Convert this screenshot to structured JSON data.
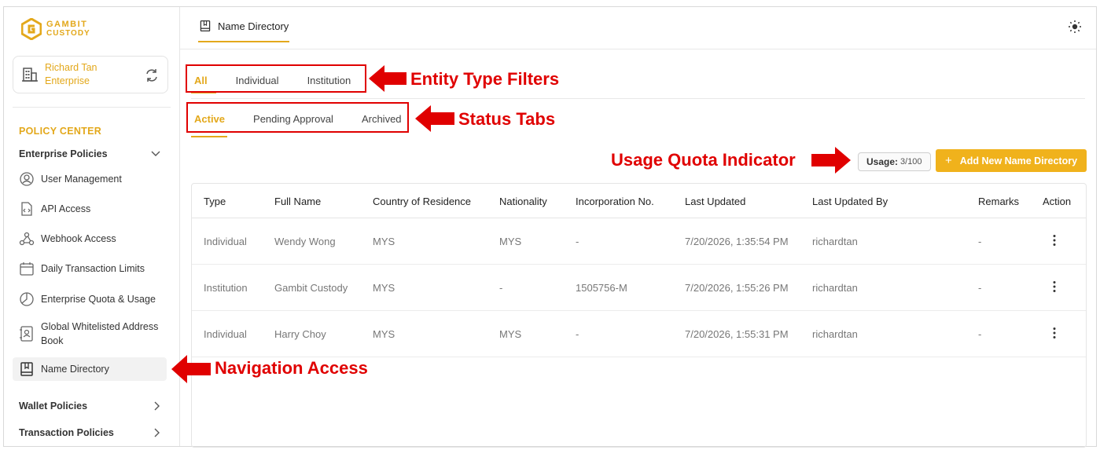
{
  "brand": {
    "line1": "GAMBIT",
    "line2": "CUSTODY",
    "accent": "#e3a81b"
  },
  "org": {
    "name": "Richard Tan Enterprise"
  },
  "sidebar": {
    "section_title": "POLICY CENTER",
    "enterprise_group": "Enterprise Policies",
    "items": [
      {
        "label": "User Management",
        "icon": "user-gear-icon"
      },
      {
        "label": "API Access",
        "icon": "api-file-icon"
      },
      {
        "label": "Webhook Access",
        "icon": "webhook-icon"
      },
      {
        "label": "Daily Transaction Limits",
        "icon": "calendar-icon"
      },
      {
        "label": "Enterprise Quota & Usage",
        "icon": "pie-chart-icon"
      },
      {
        "label": "Global Whitelisted Address Book",
        "icon": "address-book-icon"
      },
      {
        "label": "Name Directory",
        "icon": "book-icon"
      }
    ],
    "wallet_group": "Wallet Policies",
    "transaction_group": "Transaction Policies"
  },
  "header": {
    "tab_label": "Name Directory"
  },
  "entity_filters": [
    "All",
    "Individual",
    "Institution"
  ],
  "status_tabs": [
    "Active",
    "Pending Approval",
    "Archived"
  ],
  "annotations": {
    "entity": "Entity Type Filters",
    "status": "Status Tabs",
    "usage": "Usage Quota Indicator",
    "navigation": "Navigation Access",
    "color": "#e00000"
  },
  "usage": {
    "label": "Usage:",
    "value": "3/100"
  },
  "add_button": {
    "icon": "+",
    "label": "Add New Name Directory"
  },
  "table": {
    "columns": [
      "Type",
      "Full Name",
      "Country of Residence",
      "Nationality",
      "Incorporation No.",
      "Last Updated",
      "Last Updated By",
      "Remarks",
      "Action"
    ],
    "rows": [
      [
        "Individual",
        "Wendy Wong",
        "MYS",
        "MYS",
        "-",
        "7/20/2026, 1:35:54 PM",
        "richardtan",
        "-"
      ],
      [
        "Institution",
        "Gambit Custody",
        "MYS",
        "-",
        "1505756-M",
        "7/20/2026, 1:55:26 PM",
        "richardtan",
        "-"
      ],
      [
        "Individual",
        "Harry Choy",
        "MYS",
        "MYS",
        "-",
        "7/20/2026, 1:55:31 PM",
        "richardtan",
        "-"
      ]
    ]
  }
}
